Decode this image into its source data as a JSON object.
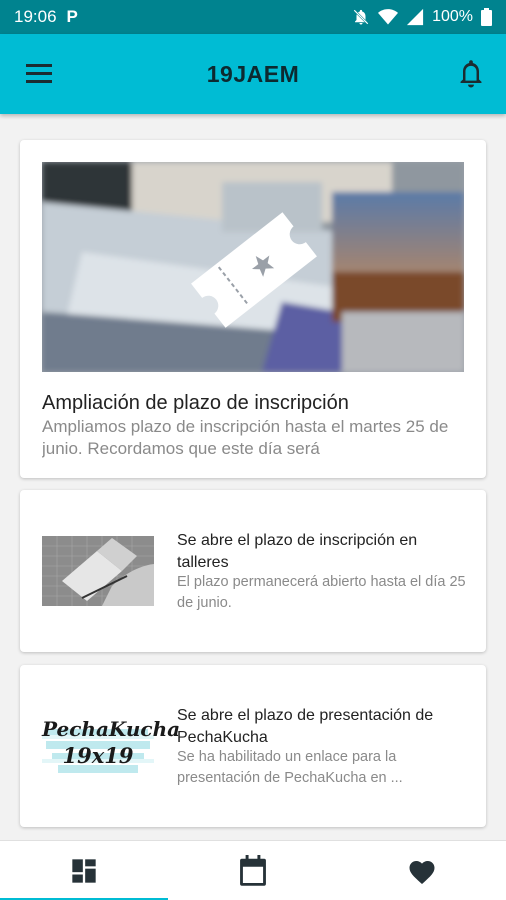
{
  "status_bar": {
    "time": "19:06",
    "notification_letter": "P",
    "battery_percent": "100%"
  },
  "app_bar": {
    "title": "19JAEM",
    "menu_icon": "hamburger-menu-icon",
    "notifications_icon": "bell-icon"
  },
  "news": [
    {
      "title": "Ampliación de plazo de inscripción",
      "summary": "Ampliamos plazo de inscripción hasta el martes 25 de junio. Recordamos que este día será",
      "image_icon": "ticket-icon"
    },
    {
      "title": "Se abre el plazo de inscripción en talleres",
      "summary": "El plazo permanecerá abierto hasta el día 25 de junio."
    },
    {
      "title": "Se abre el plazo de presentación de PechaKucha",
      "summary": "Se ha habilitado un enlace para la presentación de PechaKucha en ...",
      "logo_line1": "PechaKucha",
      "logo_line2": "19x19"
    }
  ],
  "bottom_nav": {
    "items": [
      {
        "icon": "dashboard-icon",
        "active": true
      },
      {
        "icon": "calendar-icon",
        "active": false
      },
      {
        "icon": "heart-icon",
        "active": false
      }
    ]
  },
  "colors": {
    "app_bar": "#00bcd4",
    "status_bar": "#00838f",
    "accent": "#00bcd4",
    "icon_dark": "#263238"
  }
}
